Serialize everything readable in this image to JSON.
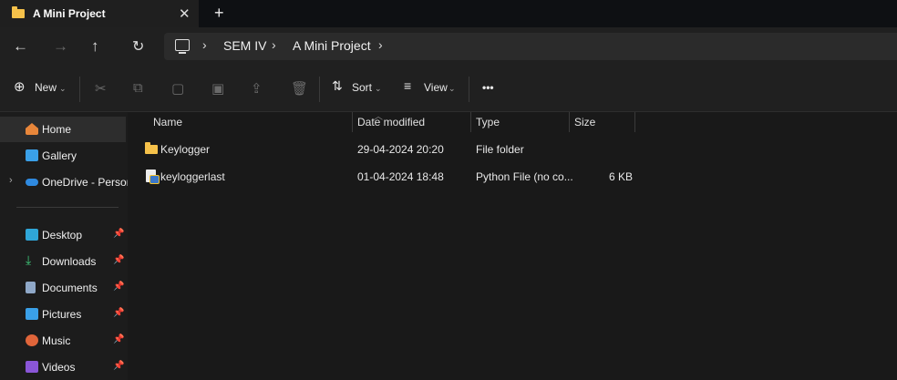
{
  "window": {
    "tab_title": "A Mini Project",
    "close_glyph": "✕",
    "newtab_glyph": "+"
  },
  "nav": {
    "back_icon": "arrow-left-icon",
    "forward_icon": "arrow-right-icon",
    "up_icon": "arrow-up-icon",
    "refresh_icon": "refresh-icon"
  },
  "breadcrumb": [
    "SEM IV",
    "A Mini Project"
  ],
  "toolbar": {
    "new_label": "New",
    "sort_label": "Sort",
    "view_label": "View",
    "more_label": "•••"
  },
  "sidebar": {
    "items": [
      {
        "label": "Home",
        "icon": "home-icon"
      },
      {
        "label": "Gallery",
        "icon": "gallery-icon"
      },
      {
        "label": "OneDrive - Persona",
        "icon": "onedrive-icon"
      },
      {
        "label": "Desktop",
        "icon": "desktop-icon"
      },
      {
        "label": "Downloads",
        "icon": "download-icon"
      },
      {
        "label": "Documents",
        "icon": "documents-icon"
      },
      {
        "label": "Pictures",
        "icon": "pictures-icon"
      },
      {
        "label": "Music",
        "icon": "music-icon"
      },
      {
        "label": "Videos",
        "icon": "videos-icon"
      }
    ]
  },
  "columns": {
    "name": "Name",
    "date": "Date modified",
    "type": "Type",
    "size": "Size"
  },
  "files": [
    {
      "name": "Keylogger",
      "date": "29-04-2024 20:20",
      "type": "File folder",
      "size": ""
    },
    {
      "name": "keyloggerlast",
      "date": "01-04-2024 18:48",
      "type": "Python File (no co...",
      "size": "6 KB"
    }
  ],
  "colors": {
    "folder": "#f5c14a",
    "background": "#191919",
    "selected": "#2d2d2d"
  }
}
